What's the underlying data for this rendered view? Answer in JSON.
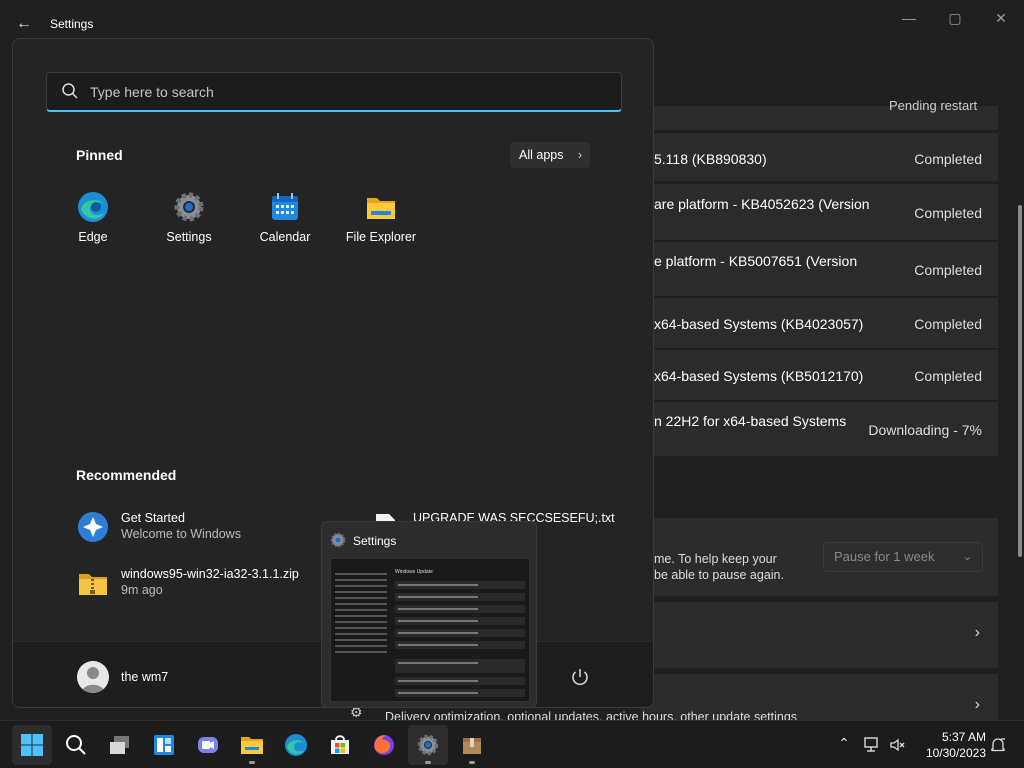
{
  "window": {
    "title": "Settings",
    "back_glyph": "←",
    "minimize_glyph": "—",
    "maximize_glyph": "▢",
    "close_glyph": "✕"
  },
  "updates": {
    "pending_text": "Pending restart",
    "items": [
      {
        "name": "5.118 (KB890830)",
        "status": "Completed"
      },
      {
        "name": "are platform - KB4052623 (Version",
        "status": "Completed"
      },
      {
        "name": "e platform - KB5007651 (Version",
        "status": "Completed"
      },
      {
        "name": "x64-based Systems (KB4023057)",
        "status": "Completed"
      },
      {
        "name": "x64-based Systems (KB5012170)",
        "status": "Completed"
      },
      {
        "name": "n 22H2 for x64-based Systems",
        "status": "Downloading - 7%"
      }
    ]
  },
  "pause": {
    "line1": "me. To help keep your",
    "line2": "be able to pause again.",
    "select_value": "Pause for 1 week",
    "chevron": "⌄"
  },
  "nav_chevron": "›",
  "bottom_text": "Delivery optimization, optional updates, active hours, other update settings",
  "start_menu": {
    "search_placeholder": "Type here to search",
    "pinned_title": "Pinned",
    "all_apps_label": "All apps",
    "all_apps_chevron": "›",
    "pinned": [
      {
        "label": "Edge",
        "icon": "edge-icon"
      },
      {
        "label": "Settings",
        "icon": "settings-gear-icon"
      },
      {
        "label": "Calendar",
        "icon": "calendar-icon"
      },
      {
        "label": "File Explorer",
        "icon": "folder-icon"
      }
    ],
    "recommended_title": "Recommended",
    "recommended": [
      {
        "title": "Get Started",
        "subtitle": "Welcome to Windows",
        "icon": "get-started-icon"
      },
      {
        "title": "UPGRADE WAS SECCSESEFU;.txt",
        "subtitle": "",
        "icon": "text-file-icon"
      },
      {
        "title": "windows95-win32-ia32-3.1.1.zip",
        "subtitle": "9m ago",
        "icon": "zip-folder-icon"
      }
    ],
    "user_name": "the wm7"
  },
  "thumbnail": {
    "title": "Settings",
    "inner_heading": "Windows Update"
  },
  "taskbar": {
    "apps": [
      "start-icon",
      "search-icon",
      "task-view-icon",
      "widgets-icon",
      "teams-chat-icon",
      "file-explorer-icon",
      "edge-icon",
      "store-icon",
      "firefox-icon",
      "settings-icon",
      "package-icon"
    ],
    "time": "5:37 AM",
    "date": "10/30/2023"
  },
  "colors": {
    "accent": "#4cc2ff",
    "start_bg": "#242424",
    "window_bg": "#202020",
    "card_bg": "#2b2b2b"
  }
}
